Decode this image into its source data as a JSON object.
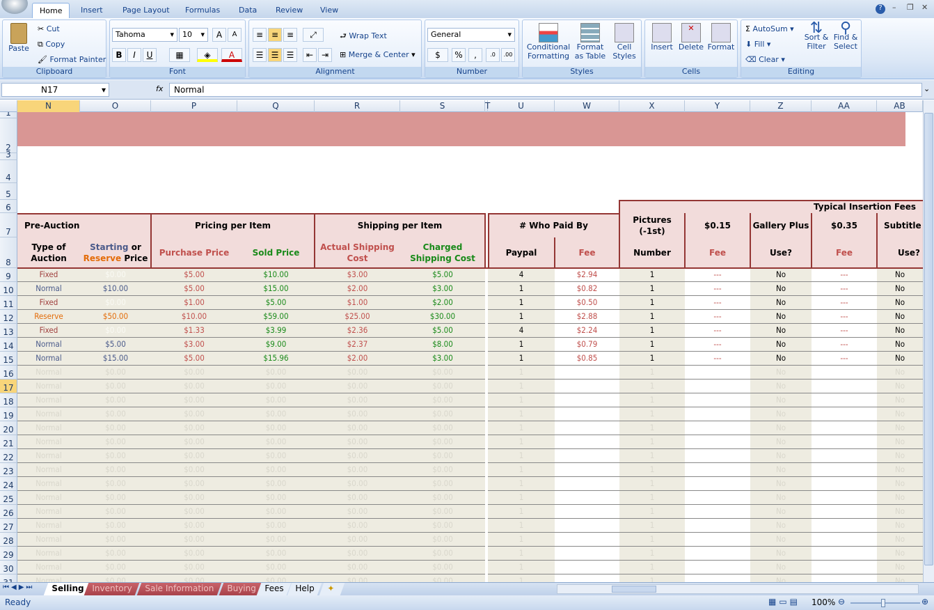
{
  "ribbon_tabs": [
    "Home",
    "Insert",
    "Page Layout",
    "Formulas",
    "Data",
    "Review",
    "View"
  ],
  "clipboard": {
    "paste": "Paste",
    "cut": "Cut",
    "copy": "Copy",
    "format_painter": "Format Painter",
    "label": "Clipboard"
  },
  "font": {
    "name": "Tahoma",
    "size": "10",
    "label": "Font",
    "bold": "B",
    "italic": "I",
    "underline": "U"
  },
  "alignment": {
    "wrap": "Wrap Text",
    "merge": "Merge & Center",
    "label": "Alignment"
  },
  "number": {
    "format": "General",
    "currency": "$",
    "percent": "%",
    "comma": ",",
    "label": "Number"
  },
  "styles": {
    "conditional": "Conditional Formatting",
    "format_table": "Format as Table",
    "cell_styles": "Cell Styles",
    "label": "Styles"
  },
  "cells": {
    "insert": "Insert",
    "delete": "Delete",
    "format": "Format",
    "label": "Cells"
  },
  "editing": {
    "autosum": "AutoSum",
    "fill": "Fill",
    "clear": "Clear",
    "sort": "Sort & Filter",
    "find": "Find & Select",
    "label": "Editing"
  },
  "formula_bar": {
    "name_box": "N17",
    "fx": "fx",
    "value": "Normal"
  },
  "columns": [
    "N",
    "O",
    "P",
    "Q",
    "R",
    "S",
    "T",
    "U",
    "W",
    "X",
    "Y",
    "Z",
    "AA",
    "AB"
  ],
  "row_numbers": [
    "1",
    "2",
    "3",
    "4",
    "5",
    "6",
    "7",
    "8",
    "9",
    "10",
    "11",
    "12",
    "13",
    "14",
    "15",
    "16",
    "17",
    "18",
    "19",
    "20",
    "21",
    "22",
    "23",
    "24",
    "25",
    "26",
    "27",
    "28",
    "29",
    "30",
    "31"
  ],
  "headers": {
    "pre_auction": "Pre-Auction",
    "type_of_auction": "Type of Auction",
    "starting": "Starting",
    "or": " or ",
    "reserve": "Reserve",
    "price": " Price",
    "pricing_per_item": "Pricing per Item",
    "purchase_price": "Purchase Price",
    "sold_price": "Sold Price",
    "shipping_per_item": "Shipping per Item",
    "actual_shipping": "Actual Shipping Cost",
    "charged_shipping": "Charged Shipping Cost",
    "who_paid_by": "# Who Paid By",
    "paypal": "Paypal",
    "fee": "Fee",
    "typical_insertion_fees": "Typical Insertion Fees",
    "pictures": "Pictures (-1st)",
    "number": "Number",
    "fee_015": "$0.15",
    "gallery_plus": "Gallery Plus",
    "use": "Use?",
    "fee_035": "$0.35",
    "subtitle": "Subtitle"
  },
  "rows": [
    [
      "Fixed",
      "$0.00",
      "$5.00",
      "$10.00",
      "$3.00",
      "$5.00",
      "4",
      "$2.94",
      "1",
      "---",
      "No",
      "---",
      "No"
    ],
    [
      "Normal",
      "$10.00",
      "$5.00",
      "$15.00",
      "$2.00",
      "$3.00",
      "1",
      "$0.82",
      "1",
      "---",
      "No",
      "---",
      "No"
    ],
    [
      "Fixed",
      "$0.00",
      "$1.00",
      "$5.00",
      "$1.00",
      "$2.00",
      "1",
      "$0.50",
      "1",
      "---",
      "No",
      "---",
      "No"
    ],
    [
      "Reserve",
      "$50.00",
      "$10.00",
      "$59.00",
      "$25.00",
      "$30.00",
      "1",
      "$2.88",
      "1",
      "---",
      "No",
      "---",
      "No"
    ],
    [
      "Fixed",
      "$0.00",
      "$1.33",
      "$3.99",
      "$2.36",
      "$5.00",
      "4",
      "$2.24",
      "1",
      "---",
      "No",
      "---",
      "No"
    ],
    [
      "Normal",
      "$5.00",
      "$3.00",
      "$9.00",
      "$2.37",
      "$8.00",
      "1",
      "$0.79",
      "1",
      "---",
      "No",
      "---",
      "No"
    ],
    [
      "Normal",
      "$15.00",
      "$5.00",
      "$15.96",
      "$2.00",
      "$3.00",
      "1",
      "$0.85",
      "1",
      "---",
      "No",
      "---",
      "No"
    ]
  ],
  "empty_row": [
    "Normal",
    "$0.00",
    "$0.00",
    "$0.00",
    "$0.00",
    "$0.00",
    "1",
    "",
    "1",
    "",
    "No",
    "",
    "No"
  ],
  "sheet_tabs": [
    "Selling",
    "Inventory",
    "Sale Information",
    "Buying",
    "Fees",
    "Help"
  ],
  "status": {
    "ready": "Ready",
    "zoom": "100%"
  },
  "colors": {
    "header_fill": "#f2dcdb",
    "banner": "#d99694",
    "border": "#943634",
    "red": "#c0504d",
    "green": "#1a8a1a",
    "blue": "#4a5a8a",
    "orange": "#e36c09",
    "beige": "#eeece1"
  }
}
